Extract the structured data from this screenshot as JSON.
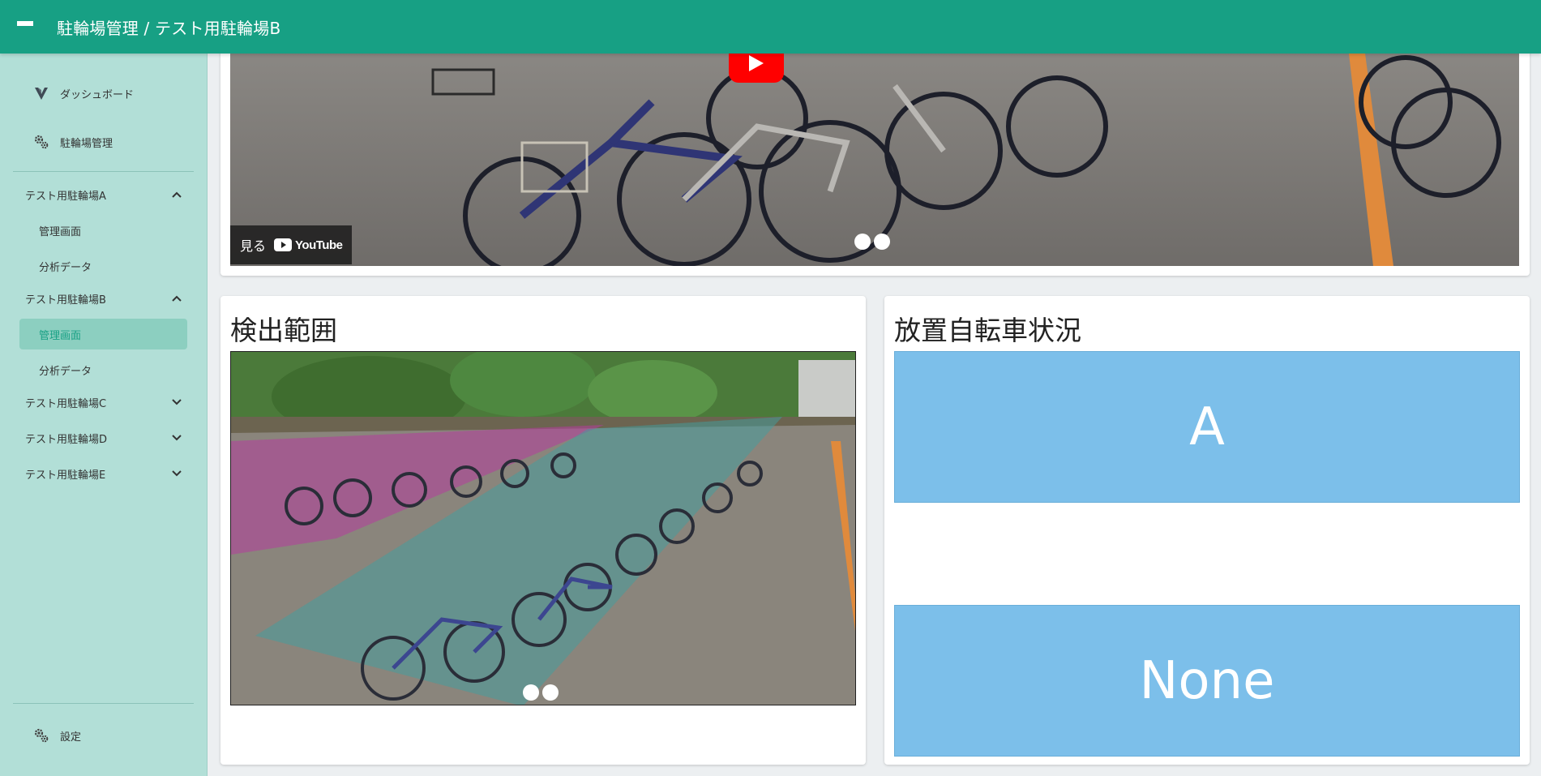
{
  "appbar": {
    "title": "駐輪場管理 / テスト用駐輪場B"
  },
  "sidebar": {
    "top_items": [
      {
        "label": "ダッシュボード",
        "icon": "vuetify-logo-icon"
      },
      {
        "label": "駐輪場管理",
        "icon": "gears-icon"
      }
    ],
    "groups": [
      {
        "label": "テスト用駐輪場A",
        "expanded": true,
        "items": [
          "管理画面",
          "分析データ"
        ]
      },
      {
        "label": "テスト用駐輪場B",
        "expanded": true,
        "items": [
          "管理画面",
          "分析データ"
        ],
        "active_item": "管理画面"
      },
      {
        "label": "テスト用駐輪場C",
        "expanded": false
      },
      {
        "label": "テスト用駐輪場D",
        "expanded": false
      },
      {
        "label": "テスト用駐輪場E",
        "expanded": false
      }
    ],
    "settings": {
      "label": "設定",
      "icon": "gears-icon"
    }
  },
  "video": {
    "watch_label": "見る",
    "youtube_label": "YouTube"
  },
  "detection": {
    "title": "検出範囲"
  },
  "status": {
    "title": "放置自転車状況",
    "box1": "A",
    "box2": "None"
  },
  "colors": {
    "appbar": "#17a084",
    "sidebar": "#b2dfd7",
    "active_item_bg": "#8ccfc0",
    "status_box": "#7cbfea",
    "youtube_red": "#ff0000",
    "zone_purple": "#b43c9c",
    "zone_teal": "#3fa0a0"
  }
}
